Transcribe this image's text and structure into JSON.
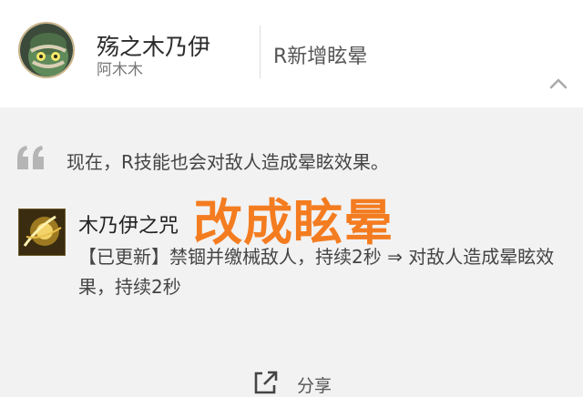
{
  "header": {
    "champion_name": "殇之木乃伊",
    "champion_alias": "阿木木",
    "change_title": "R新增眩晕",
    "avatar_icon": "champion-portrait-icon",
    "collapse_icon": "chevron-up-icon"
  },
  "summary": {
    "quote_icon": "quote-mark-icon",
    "text": "现在，R技能也会对敌人造成晕眩效果。"
  },
  "ability": {
    "icon": "ability-curse-icon",
    "name": "木乃伊之咒",
    "overlay_caption": "改成眩晕",
    "description": "【已更新】禁锢并缴械敌人，持续2秒 ⇒ 对敌人造成晕眩效果，持续2秒"
  },
  "footer": {
    "share_label": "分享",
    "share_icon": "share-arrow-icon"
  },
  "colors": {
    "overlay": "#f47c20",
    "header_bg": "#ffffff",
    "content_bg": "#f2f2f2"
  }
}
